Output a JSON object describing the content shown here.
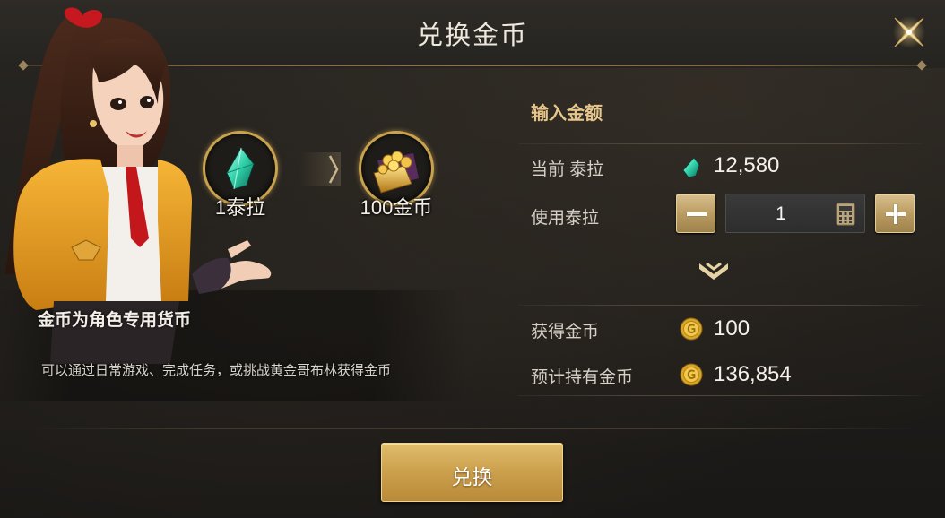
{
  "dialog": {
    "title": "兑换金币",
    "close_icon": "close-x-icon"
  },
  "conversion": {
    "from_label": "1泰拉",
    "to_label": "100金币",
    "from_icon": "tera-gem-icon",
    "to_icon": "gold-chest-icon",
    "arrow_icon": "chevron-right-icon"
  },
  "info": {
    "title": "金币为角色专用货币",
    "description": "可以通过日常游戏、完成任务，或挑战黄金哥布林获得金币"
  },
  "input_section": {
    "title": "输入金额",
    "current_tera_label": "当前 泰拉",
    "current_tera_value": "12,580",
    "use_tera_label": "使用泰拉",
    "use_tera_value": "1",
    "obtain_gold_label": "获得金币",
    "obtain_gold_value": "100",
    "expected_gold_label": "预计持有金币",
    "expected_gold_value": "136,854"
  },
  "actions": {
    "exchange_label": "兑换"
  },
  "colors": {
    "accent_gold": "#cda24f",
    "section_title": "#e6c68b",
    "tera_gem": "#2fd0a8"
  }
}
